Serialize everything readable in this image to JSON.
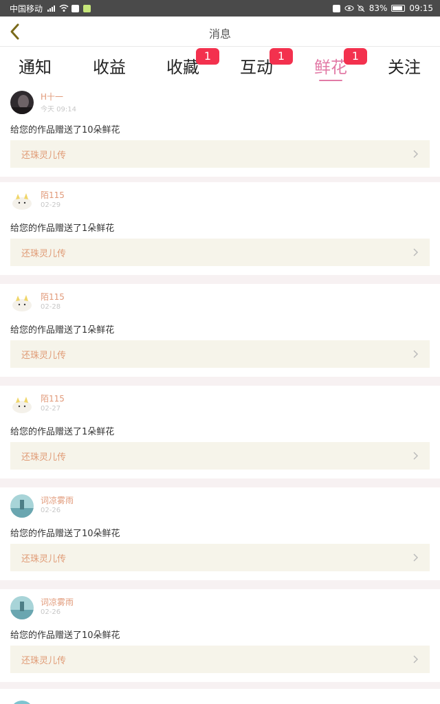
{
  "status": {
    "carrier": "中国移动",
    "battery": "83%",
    "time": "09:15"
  },
  "header": {
    "title": "消息"
  },
  "tabs": [
    {
      "label": "通知"
    },
    {
      "label": "收益"
    },
    {
      "label": "收藏",
      "badge": "1"
    },
    {
      "label": "互动",
      "badge": "1"
    },
    {
      "label": "鲜花",
      "badge": "1",
      "active": true
    },
    {
      "label": "关注"
    }
  ],
  "messages": [
    {
      "name": "H十一",
      "date": "今天 09:14",
      "text": "给您的作品赠送了10朵鲜花",
      "work": "还珠灵儿传",
      "avatar": "dark-avatar"
    },
    {
      "name": "陌115",
      "date": "02-29",
      "text": "给您的作品赠送了1朵鲜花",
      "work": "还珠灵儿传",
      "avatar": "cat-avatar"
    },
    {
      "name": "陌115",
      "date": "02-28",
      "text": "给您的作品赠送了1朵鲜花",
      "work": "还珠灵儿传",
      "avatar": "cat-avatar"
    },
    {
      "name": "陌115",
      "date": "02-27",
      "text": "给您的作品赠送了1朵鲜花",
      "work": "还珠灵儿传",
      "avatar": "cat-avatar"
    },
    {
      "name": "词凉雾雨",
      "date": "02-26",
      "text": "给您的作品赠送了10朵鲜花",
      "work": "还珠灵儿传",
      "avatar": "landscape-avatar"
    },
    {
      "name": "词凉雾雨",
      "date": "02-26",
      "text": "给您的作品赠送了10朵鲜花",
      "work": "还珠灵儿传",
      "avatar": "landscape-avatar"
    }
  ],
  "colors": {
    "accent": "#e27aa6",
    "badge": "#f3314e",
    "name": "#e19a7a",
    "card": "#f6f4ea"
  }
}
